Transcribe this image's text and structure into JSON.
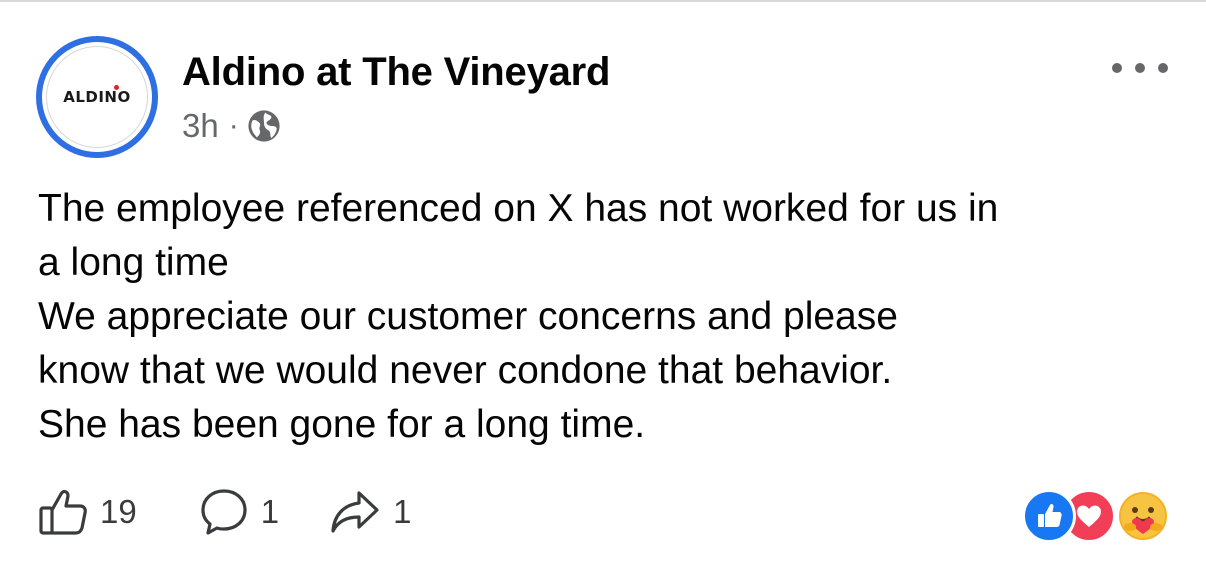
{
  "post": {
    "page_name": "Aldino at The Vineyard",
    "avatar_logo_text": "ALDINO",
    "timestamp": "3h",
    "separator": "·",
    "audience_icon": "globe-icon",
    "more_icon": "more-options-icon",
    "body_lines": [
      "The employee referenced on X has not worked for us in",
      "a long time",
      "We appreciate our customer concerns and please",
      "know that we would never condone that behavior.",
      "She has been gone for a long time."
    ]
  },
  "actions": {
    "like": {
      "icon": "like-icon",
      "count": "19"
    },
    "comment": {
      "icon": "comment-icon",
      "count": "1"
    },
    "share": {
      "icon": "share-icon",
      "count": "1"
    }
  },
  "reactions": [
    "like",
    "love",
    "care"
  ],
  "colors": {
    "avatar_ring": "#2f6fe4",
    "like_blue": "#1877f2",
    "love_red": "#f33e58",
    "care_yellow": "#f7b125",
    "meta_gray": "#65676b"
  }
}
